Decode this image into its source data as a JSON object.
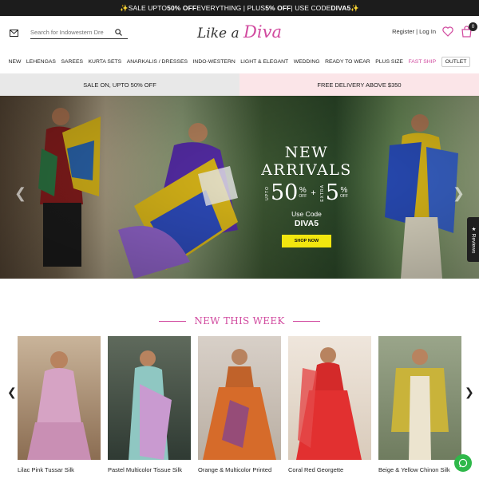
{
  "announcement": {
    "sparkle_left": "✨",
    "part1": " SALE UPTO ",
    "part2": "50% OFF",
    "part3": " EVERYTHING | PLUS ",
    "part4": "5% OFF",
    "part5": " | USE CODE ",
    "part6": "DIVA5",
    "sparkle_right": " ✨"
  },
  "header": {
    "search_placeholder": "Search for Indowestern Dre",
    "logo_text": "Like a ",
    "logo_accent": "Diva",
    "register_login": "Register | Log In",
    "cart_count": "0"
  },
  "nav": {
    "items": [
      "NEW",
      "LEHENGAS",
      "SAREES",
      "KURTA SETS",
      "ANARKALIS / DRESSES",
      "INDO-WESTERN",
      "LIGHT & ELEGANT",
      "WEDDING",
      "READY TO WEAR",
      "PLUS SIZE"
    ],
    "fast_ship": "FAST SHIP",
    "outlet": "OUTLET"
  },
  "promo_strip": {
    "left": "SALE ON, UPTO 50% OFF",
    "right": "FREE DELIVERY ABOVE $350"
  },
  "hero": {
    "heading": "NEW ARRIVALS",
    "upto": "UPTO",
    "offer1": "50",
    "percent": "%",
    "off": "OFF",
    "plus": "+",
    "extra": "EXTRA",
    "offer2": "5",
    "code_label": "Use Code",
    "code": "DIVA5",
    "button": "SHOP NOW"
  },
  "reviews_tab": "★ Reviews",
  "section": {
    "title": "NEW THIS WEEK"
  },
  "products": [
    {
      "name": "Lilac Pink Tussar Silk"
    },
    {
      "name": "Pastel Multicolor Tissue Silk"
    },
    {
      "name": "Orange & Multicolor Printed"
    },
    {
      "name": "Coral Red Georgette"
    },
    {
      "name": "Beige & Yellow Chinon Silk"
    }
  ],
  "icons": {
    "mail": "mail-icon",
    "search": "search-icon",
    "heart": "heart-icon",
    "bag": "shopping-bag-icon",
    "prev": "chevron-left-icon",
    "next": "chevron-right-icon",
    "whatsapp": "whatsapp-icon"
  },
  "colors": {
    "accent": "#d14a9f",
    "topbar": "#1c1c1c",
    "shop_button": "#f2e60f",
    "whatsapp": "#2fb84a"
  }
}
